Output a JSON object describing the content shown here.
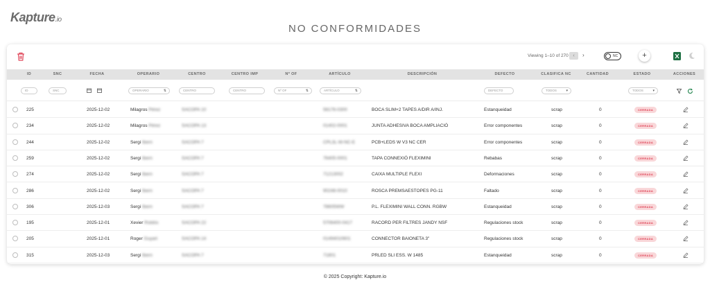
{
  "brand": {
    "logo_main": "Kapture",
    "logo_suffix": ".io"
  },
  "page": {
    "title": "NO CONFORMIDADES"
  },
  "toolbar": {
    "viewing": "Viewing 1–10 of 270",
    "toggle_label": "NC",
    "add_label": "+",
    "icons": [
      "trash-icon",
      "chevron-left-icon",
      "chevron-right-icon",
      "excel-icon",
      "moon-icon"
    ]
  },
  "columns": [
    "ID",
    "SNC",
    "FECHA",
    "OPERARIO",
    "CENTRO",
    "CENTRO IMP",
    "Nº OF",
    "ARTÍCULO",
    "DESCRIPCIÓN",
    "DEFECTO",
    "CLASIFICA NC",
    "CANTIDAD",
    "ESTADO",
    "ACCIONES"
  ],
  "filters": {
    "id": "ID",
    "snc": "SNC",
    "operario": "OPERARIO",
    "centro": "CENTRO",
    "centro_imp": "CENTRO",
    "num_of": "Nº OF",
    "articulo": "ARTÍCULO",
    "defecto": "DEFECTO",
    "clasifica": "TODOS",
    "estado": "TODOS"
  },
  "rows": [
    {
      "id": "225",
      "fecha": "2025-12-02",
      "operario": "Milagros",
      "operario_last": "Pérez",
      "centro": "SACOPA 10",
      "articulo": "58176-0300",
      "descripcion": "BOCA SLIM+2 TAPES A/DIR A/INJ.",
      "defecto": "Estanqueidad",
      "clasifica": "scrap",
      "cantidad": "0",
      "estado": "CERRADA"
    },
    {
      "id": "234",
      "fecha": "2025-12-02",
      "operario": "Milagros",
      "operario_last": "Pérez",
      "centro": "SACOPA 13",
      "articulo": "01402-0001",
      "descripcion": "JUNTA ADHESIVA BOCA AMPLIACIÓ",
      "defecto": "Error componentes",
      "clasifica": "scrap",
      "cantidad": "0",
      "estado": "CERRADA"
    },
    {
      "id": "244",
      "fecha": "2025-12-02",
      "operario": "Sergi",
      "operario_last": "Ibern",
      "centro": "SACOPA 7",
      "articulo": "CPL3L-W-NC-E",
      "descripcion": "PCB+LEDS W V3 NC CER",
      "defecto": "Error componentes",
      "clasifica": "scrap",
      "cantidad": "0",
      "estado": "CERRADA"
    },
    {
      "id": "259",
      "fecha": "2025-12-02",
      "operario": "Sergi",
      "operario_last": "Ibern",
      "centro": "SACOPA 7",
      "articulo": "76405-0001",
      "descripcion": "TAPA CONNEXIÓ FLEXIMINI",
      "defecto": "Rebabas",
      "clasifica": "scrap",
      "cantidad": "0",
      "estado": "CERRADA"
    },
    {
      "id": "274",
      "fecha": "2025-12-02",
      "operario": "Sergi",
      "operario_last": "Ibern",
      "centro": "SACOPA 7",
      "articulo": "71213002",
      "descripcion": "CAIXA MULTIPLE FLEXI",
      "defecto": "Deformaciones",
      "clasifica": "scrap",
      "cantidad": "0",
      "estado": "CERRADA"
    },
    {
      "id": "286",
      "fecha": "2025-12-02",
      "operario": "Sergi",
      "operario_last": "Ibern",
      "centro": "SACOPA 7",
      "articulo": "90248-0010",
      "descripcion": "ROSCA PREMSAESTOPES PG-11",
      "defecto": "Faltado",
      "clasifica": "scrap",
      "cantidad": "0",
      "estado": "CERRADA"
    },
    {
      "id": "306",
      "fecha": "2025-12-03",
      "operario": "Sergi",
      "operario_last": "Ibern",
      "centro": "SACOPA 7",
      "articulo": "78605WW",
      "descripcion": "P.L. FLEXIMINI WALL CONN. RGBW",
      "defecto": "Estanqueidad",
      "clasifica": "scrap",
      "cantidad": "0",
      "estado": "CERRADA"
    },
    {
      "id": "195",
      "fecha": "2025-12-01",
      "operario": "Xevier",
      "operario_last": "Roldós",
      "centro": "SACOPA 22",
      "articulo": "5706400-0417",
      "descripcion": "RACORD PER FILTRES JANDY NSF",
      "defecto": "Regulaciones stock",
      "clasifica": "scrap",
      "cantidad": "0",
      "estado": "CERRADA"
    },
    {
      "id": "205",
      "fecha": "2025-12-01",
      "operario": "Roger",
      "operario_last": "Guyart",
      "centro": "SACOPA 14",
      "articulo": "01494010601",
      "descripcion": "CONNECTOR BAIONETA 3\"",
      "defecto": "Regulaciones stock",
      "clasifica": "scrap",
      "cantidad": "0",
      "estado": "CERRADA"
    },
    {
      "id": "315",
      "fecha": "2025-12-03",
      "operario": "Sergi",
      "operario_last": "Ibern",
      "centro": "SACOPA 7",
      "articulo": "71801",
      "descripcion": "PRLED SLI ESS. W 1485",
      "defecto": "Estanqueidad",
      "clasifica": "scrap",
      "cantidad": "0",
      "estado": "CERRADA"
    }
  ],
  "footer": {
    "copyright": "© 2025 Copyright:",
    "brand": "Kapture.io"
  },
  "colors": {
    "danger": "#e0475a",
    "badge_bg": "#f9d7d9",
    "header_bg": "#e3e3e3",
    "excel": "#1d6f42",
    "refresh": "#2e8b57"
  }
}
